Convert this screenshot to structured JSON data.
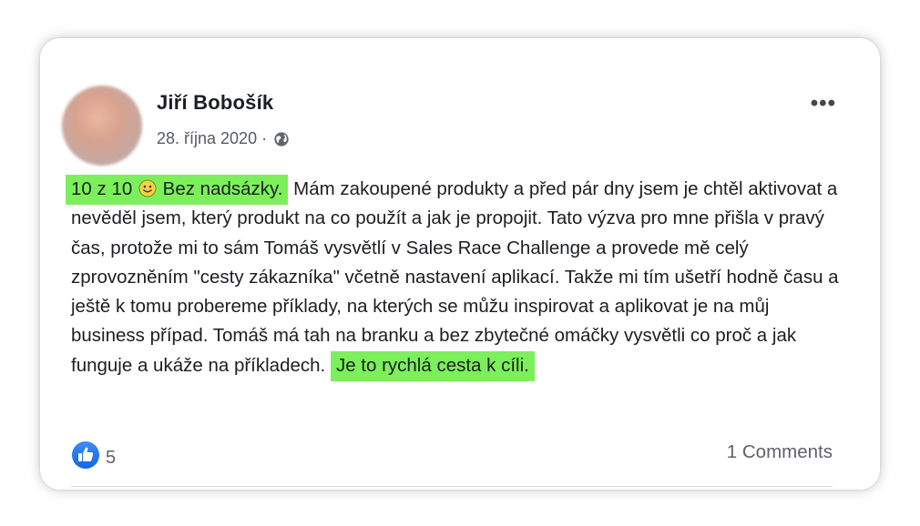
{
  "post": {
    "author": "Jiří Bobošík",
    "date": "28. října 2020",
    "separator": "·",
    "privacy_icon": "globe-icon",
    "more_label": "•••",
    "text": {
      "highlight_start_a": "10 z 10",
      "emoji": "smiley-icon",
      "highlight_start_b": "Bez nadsázky.",
      "body": "Mám zakoupené produkty a před pár dny jsem je chtěl aktivovat a nevěděl jsem, který produkt na co použít a jak je propojit. Tato výzva pro mne přišla v pravý čas, protože mi to sám Tomáš vysvětlí v Sales Race Challenge a provede mě celý zprovozněním \"cesty zákazníka\" včetně nastavení aplikací. Takže mi tím ušetří hodně času a ještě k tomu probereme příklady, na kterých se můžu inspirovat a aplikovat je na můj business případ. Tomáš má tah na branku a bez zbytečné omáčky vysvětli co proč a jak funguje a ukáže na příkladech.",
      "highlight_end": "Je to rychlá cesta k cíli."
    },
    "reactions": {
      "icon": "like-icon",
      "count": "5"
    },
    "comments_label": "1 Comments"
  },
  "colors": {
    "highlight": "#7cf05a",
    "like_blue": "#1877f2",
    "text": "#1c1e21",
    "secondary_text": "#5e6268"
  }
}
